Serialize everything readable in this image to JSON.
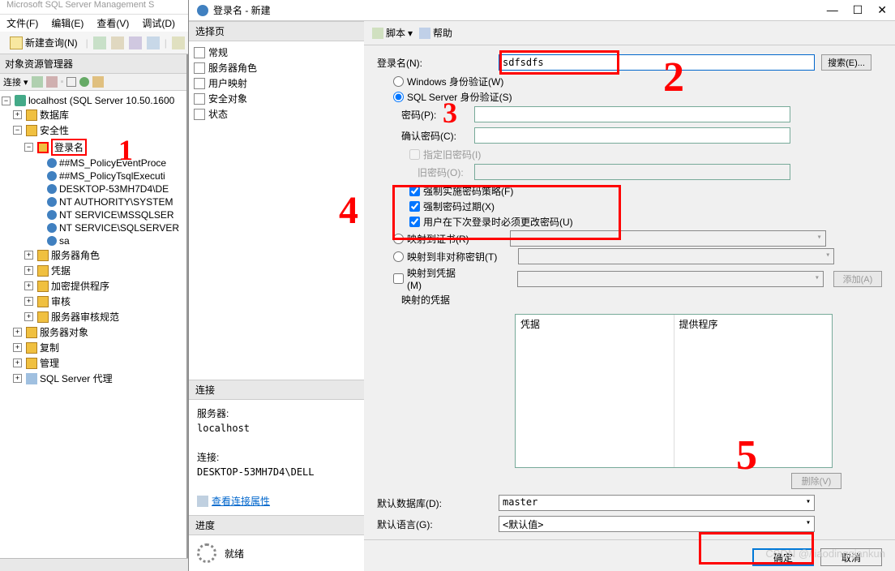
{
  "main_title": "Microsoft SQL Server Management S",
  "menu": {
    "file": "文件(F)",
    "edit": "编辑(E)",
    "view": "查看(V)",
    "debug": "调试(D)"
  },
  "toolbar": {
    "new_query": "新建查询(N)"
  },
  "explorer": {
    "title": "对象资源管理器",
    "connect": "连接 ▾",
    "root": "localhost (SQL Server 10.50.1600",
    "nodes": {
      "databases": "数据库",
      "security": "安全性",
      "logins": "登录名",
      "login_items": [
        "##MS_PolicyEventProce",
        "##MS_PolicyTsqlExecuti",
        "DESKTOP-53MH7D4\\DE",
        "NT AUTHORITY\\SYSTEM",
        "NT SERVICE\\MSSQLSER",
        "NT SERVICE\\SQLSERVER",
        "sa"
      ],
      "server_roles": "服务器角色",
      "credentials": "凭据",
      "crypto": "加密提供程序",
      "audit": "审核",
      "audit_spec": "服务器审核规范",
      "server_objects": "服务器对象",
      "replication": "复制",
      "management": "管理",
      "agent": "SQL Server 代理"
    }
  },
  "dialog": {
    "title": "登录名 - 新建",
    "pages_header": "选择页",
    "pages": [
      "常规",
      "服务器角色",
      "用户映射",
      "安全对象",
      "状态"
    ],
    "script": "脚本",
    "help": "帮助",
    "conn_header": "连接",
    "server_lbl": "服务器:",
    "server_val": "localhost",
    "conn_lbl": "连接:",
    "conn_val": "DESKTOP-53MH7D4\\DELL",
    "view_conn": "查看连接属性",
    "progress_header": "进度",
    "progress_status": "就绪",
    "login_name_lbl": "登录名(N):",
    "login_name_val": "sdfsdfs",
    "search_btn": "搜索(E)...",
    "auth_win": "Windows 身份验证(W)",
    "auth_sql": "SQL Server 身份验证(S)",
    "pwd_lbl": "密码(P):",
    "pwd2_lbl": "确认密码(C):",
    "old_pwd_chk": "指定旧密码(I)",
    "old_pwd_lbl": "旧密码(O):",
    "enforce_policy": "强制实施密码策略(F)",
    "enforce_expire": "强制密码过期(X)",
    "must_change": "用户在下次登录时必须更改密码(U)",
    "map_cert": "映射到证书(R)",
    "map_asym": "映射到非对称密钥(T)",
    "map_cred": "映射到凭据(M)",
    "add_btn": "添加(A)",
    "cred_lbl": "映射的凭据",
    "cred_col1": "凭据",
    "cred_col2": "提供程序",
    "remove_btn": "删除(V)",
    "default_db_lbl": "默认数据库(D):",
    "default_db_val": "master",
    "default_lang_lbl": "默认语言(G):",
    "default_lang_val": "<默认值>",
    "ok": "确定",
    "cancel": "取消"
  },
  "annotations": {
    "a1": "1",
    "a2": "2",
    "a3": "3",
    "a4": "4",
    "a5": "5"
  },
  "watermark": "CSDN @/jiaodingqiankun"
}
